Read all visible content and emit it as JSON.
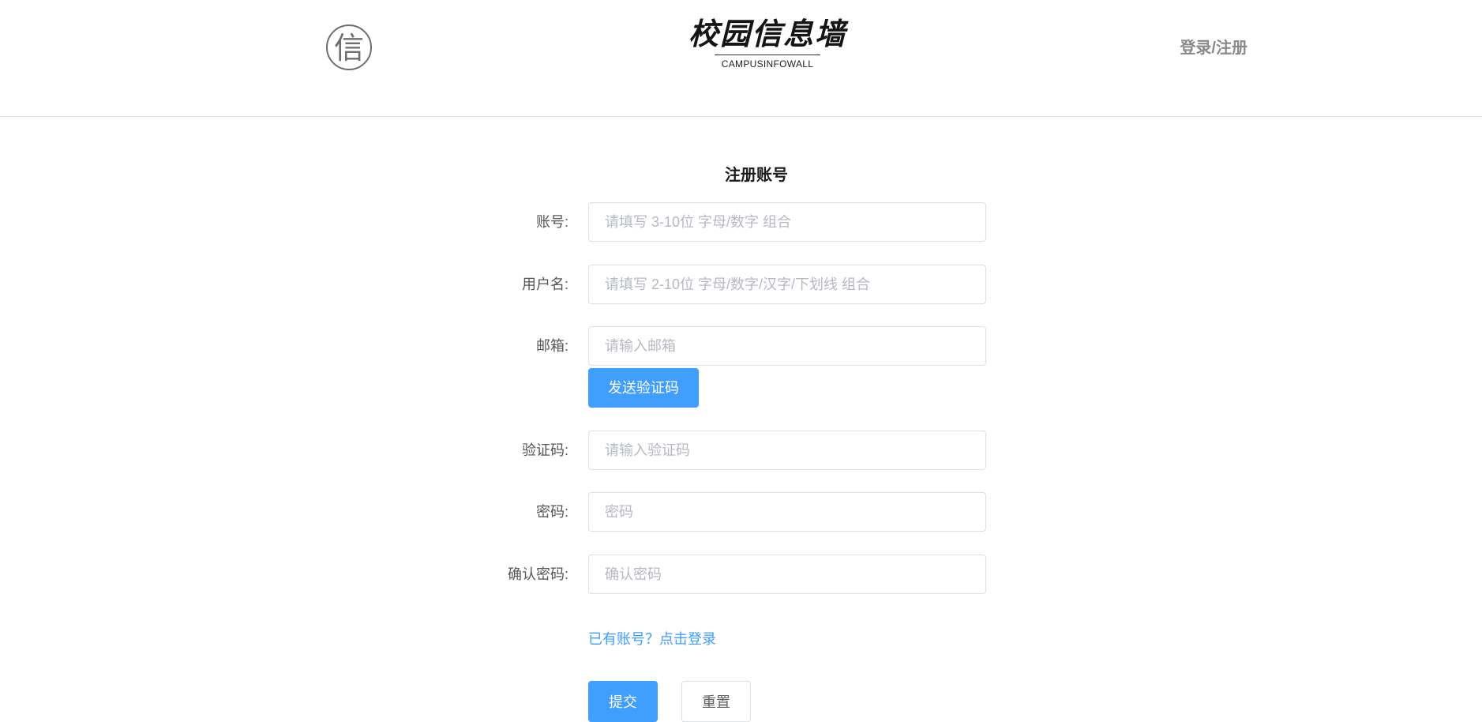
{
  "header": {
    "seal_char": "信",
    "logo_title": "校园信息墙",
    "logo_subtitle": "CAMPUSINFOWALL",
    "nav_login_register": "登录/注册"
  },
  "form": {
    "title": "注册账号",
    "fields": [
      {
        "label": "账号:",
        "placeholder": "请填写 3-10位 字母/数字 组合",
        "value": ""
      },
      {
        "label": "用户名:",
        "placeholder": "请填写 2-10位 字母/数字/汉字/下划线 组合",
        "value": ""
      },
      {
        "label": "邮箱:",
        "placeholder": "请输入邮箱",
        "value": ""
      },
      {
        "label": "验证码:",
        "placeholder": "请输入验证码",
        "value": ""
      },
      {
        "label": "密码:",
        "placeholder": "密码",
        "value": ""
      },
      {
        "label": "确认密码:",
        "placeholder": "确认密码",
        "value": ""
      }
    ],
    "send_code_label": "发送验证码",
    "login_link": "已有账号？点击登录",
    "submit_label": "提交",
    "reset_label": "重置"
  },
  "colors": {
    "accent": "#409eff",
    "input_border": "#dcdfe6",
    "placeholder": "#b6b9c0",
    "header_border": "#e2e2e2",
    "nav_text": "#8a8a8a"
  }
}
